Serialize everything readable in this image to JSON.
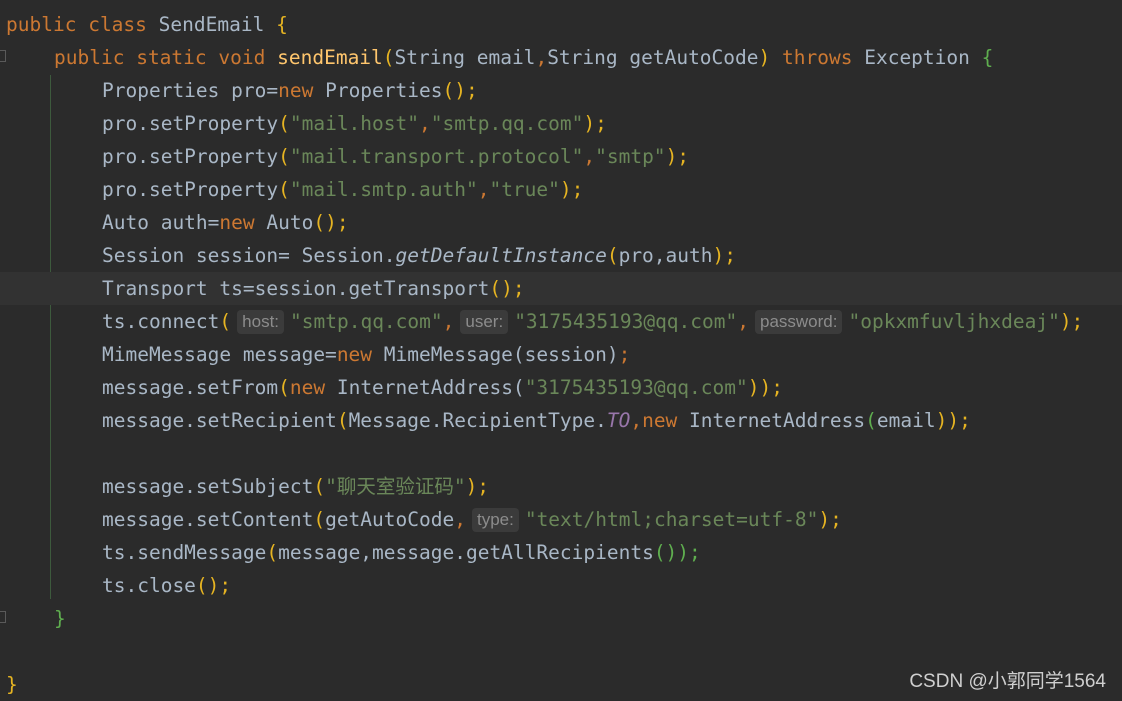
{
  "code": {
    "class_decl": {
      "kw_public": "public",
      "kw_class": "class",
      "name": "SendEmail",
      "brace": "{"
    },
    "method_decl": {
      "kw_public": "public",
      "kw_static": "static",
      "kw_void": "void",
      "name": "sendEmail",
      "lp": "(",
      "params": "String email",
      "comma": ",",
      "params2": "String getAutoCode",
      "rp": ")",
      "kw_throws": "throws",
      "exception": "Exception",
      "brace": "{"
    },
    "l1": {
      "a": "Properties pro=",
      "kw": "new",
      "b": " Properties",
      "p": "();"
    },
    "l2": {
      "a": "pro.setProperty",
      "lp": "(",
      "s1": "\"mail.host\"",
      "c": ",",
      "s2": "\"smtp.qq.com\"",
      "rp": ");"
    },
    "l3": {
      "a": "pro.setProperty",
      "lp": "(",
      "s1": "\"mail.transport.protocol\"",
      "c": ",",
      "s2": "\"smtp\"",
      "rp": ");"
    },
    "l4": {
      "a": "pro.setProperty",
      "lp": "(",
      "s1": "\"mail.smtp.auth\"",
      "c": ",",
      "s2": "\"true\"",
      "rp": ");"
    },
    "l5": {
      "a": "Auto auth=",
      "kw": "new",
      "b": " Auto",
      "p": "();"
    },
    "l6": {
      "a": "Session session= Session.",
      "m": "getDefaultInstance",
      "lp": "(",
      "args": "pro,auth",
      "rp": ");"
    },
    "l7": {
      "a": "Transport ts=session.getTransport",
      "p": "();"
    },
    "l8": {
      "a": "ts.connect",
      "lp": "(",
      "hint_host": "host:",
      "s1": "\"smtp.qq.com\"",
      "c1": ",",
      "hint_user": "user:",
      "s2": "\"3175435193@qq.com\"",
      "c2": ",",
      "hint_password": "password:",
      "s3": "\"opkxmfuvljhxdeaj\"",
      "rp": ");"
    },
    "l9": {
      "a": "MimeMessage message=",
      "kw": "new",
      "b": " MimeMessage(session)",
      "p": ";"
    },
    "l10": {
      "a": "message.setFrom",
      "lp": "(",
      "kw": "new",
      "b": " InternetAddress(",
      "s": "\"3175435193@qq.com\"",
      "rp": "));"
    },
    "l11": {
      "a": "message.setRecipient",
      "lp": "(",
      "b": "Message.RecipientType.",
      "const": "TO",
      "c": ",",
      "kw": "new",
      "d": " InternetAddress",
      "lp2": "(",
      "e": "email",
      "rp": "));"
    },
    "l12": {
      "a": "message.setSubject",
      "lp": "(",
      "s": "\"聊天室验证码\"",
      "rp": ");"
    },
    "l13": {
      "a": "message.setContent",
      "lp": "(",
      "b": "getAutoCode",
      "c": ",",
      "hint_type": "type:",
      "s": "\"text/html;charset=utf-8\"",
      "rp": ");"
    },
    "l14": {
      "a": "ts.sendMessage",
      "lp": "(",
      "b": "message,message.getAllRecipients",
      "p": "());"
    },
    "l15": {
      "a": "ts.close",
      "p": "();"
    },
    "method_close": "}",
    "class_close": "}"
  },
  "watermark": "CSDN @小郭同学1564",
  "colors": {
    "background": "#2b2b2b",
    "keyword": "#cc7832",
    "string": "#6a8759",
    "function": "#ffc66d",
    "text": "#a9b7c6",
    "constant": "#9876aa"
  }
}
